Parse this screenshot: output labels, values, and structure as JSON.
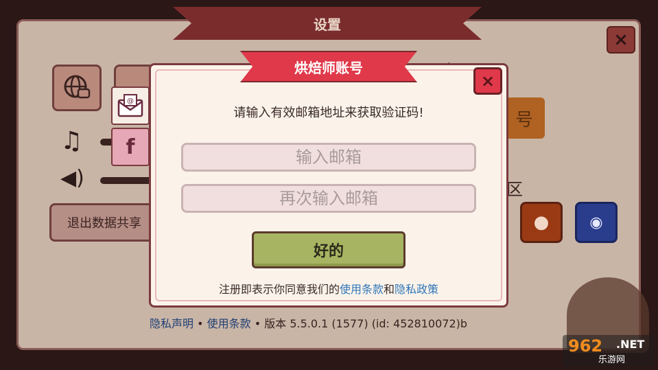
{
  "background": {
    "title": "设置",
    "close_glyph": "×",
    "exit_button": "退出数据共享",
    "account_title_partial": "账号",
    "community_partial": "区",
    "orange_button_partial": "号",
    "footer": {
      "privacy": "隐私声明",
      "sep1": " • ",
      "terms": "使用条款",
      "sep2": " • ",
      "version": "版本 5.5.0.1 (1577) (id: 452810072)b"
    }
  },
  "tabs": {
    "email_icon": "envelope-at-icon",
    "facebook_glyph": "f"
  },
  "dialog": {
    "title": "烘焙师账号",
    "close_glyph": "×",
    "instruction": "请输入有效邮箱地址来获取验证码!",
    "email_placeholder": "输入邮箱",
    "email_confirm_placeholder": "再次输入邮箱",
    "ok_label": "好的",
    "terms_prefix": "注册即表示你同意我们的",
    "terms_link": "使用条款",
    "terms_and": "和",
    "privacy_link": "隐私政策"
  },
  "watermark": {
    "number": "962",
    "net": ".NET",
    "sub": "乐游网"
  },
  "colors": {
    "accent_red": "#e0394a",
    "ok_green": "#a7b562",
    "link_blue": "#2f76b8"
  }
}
